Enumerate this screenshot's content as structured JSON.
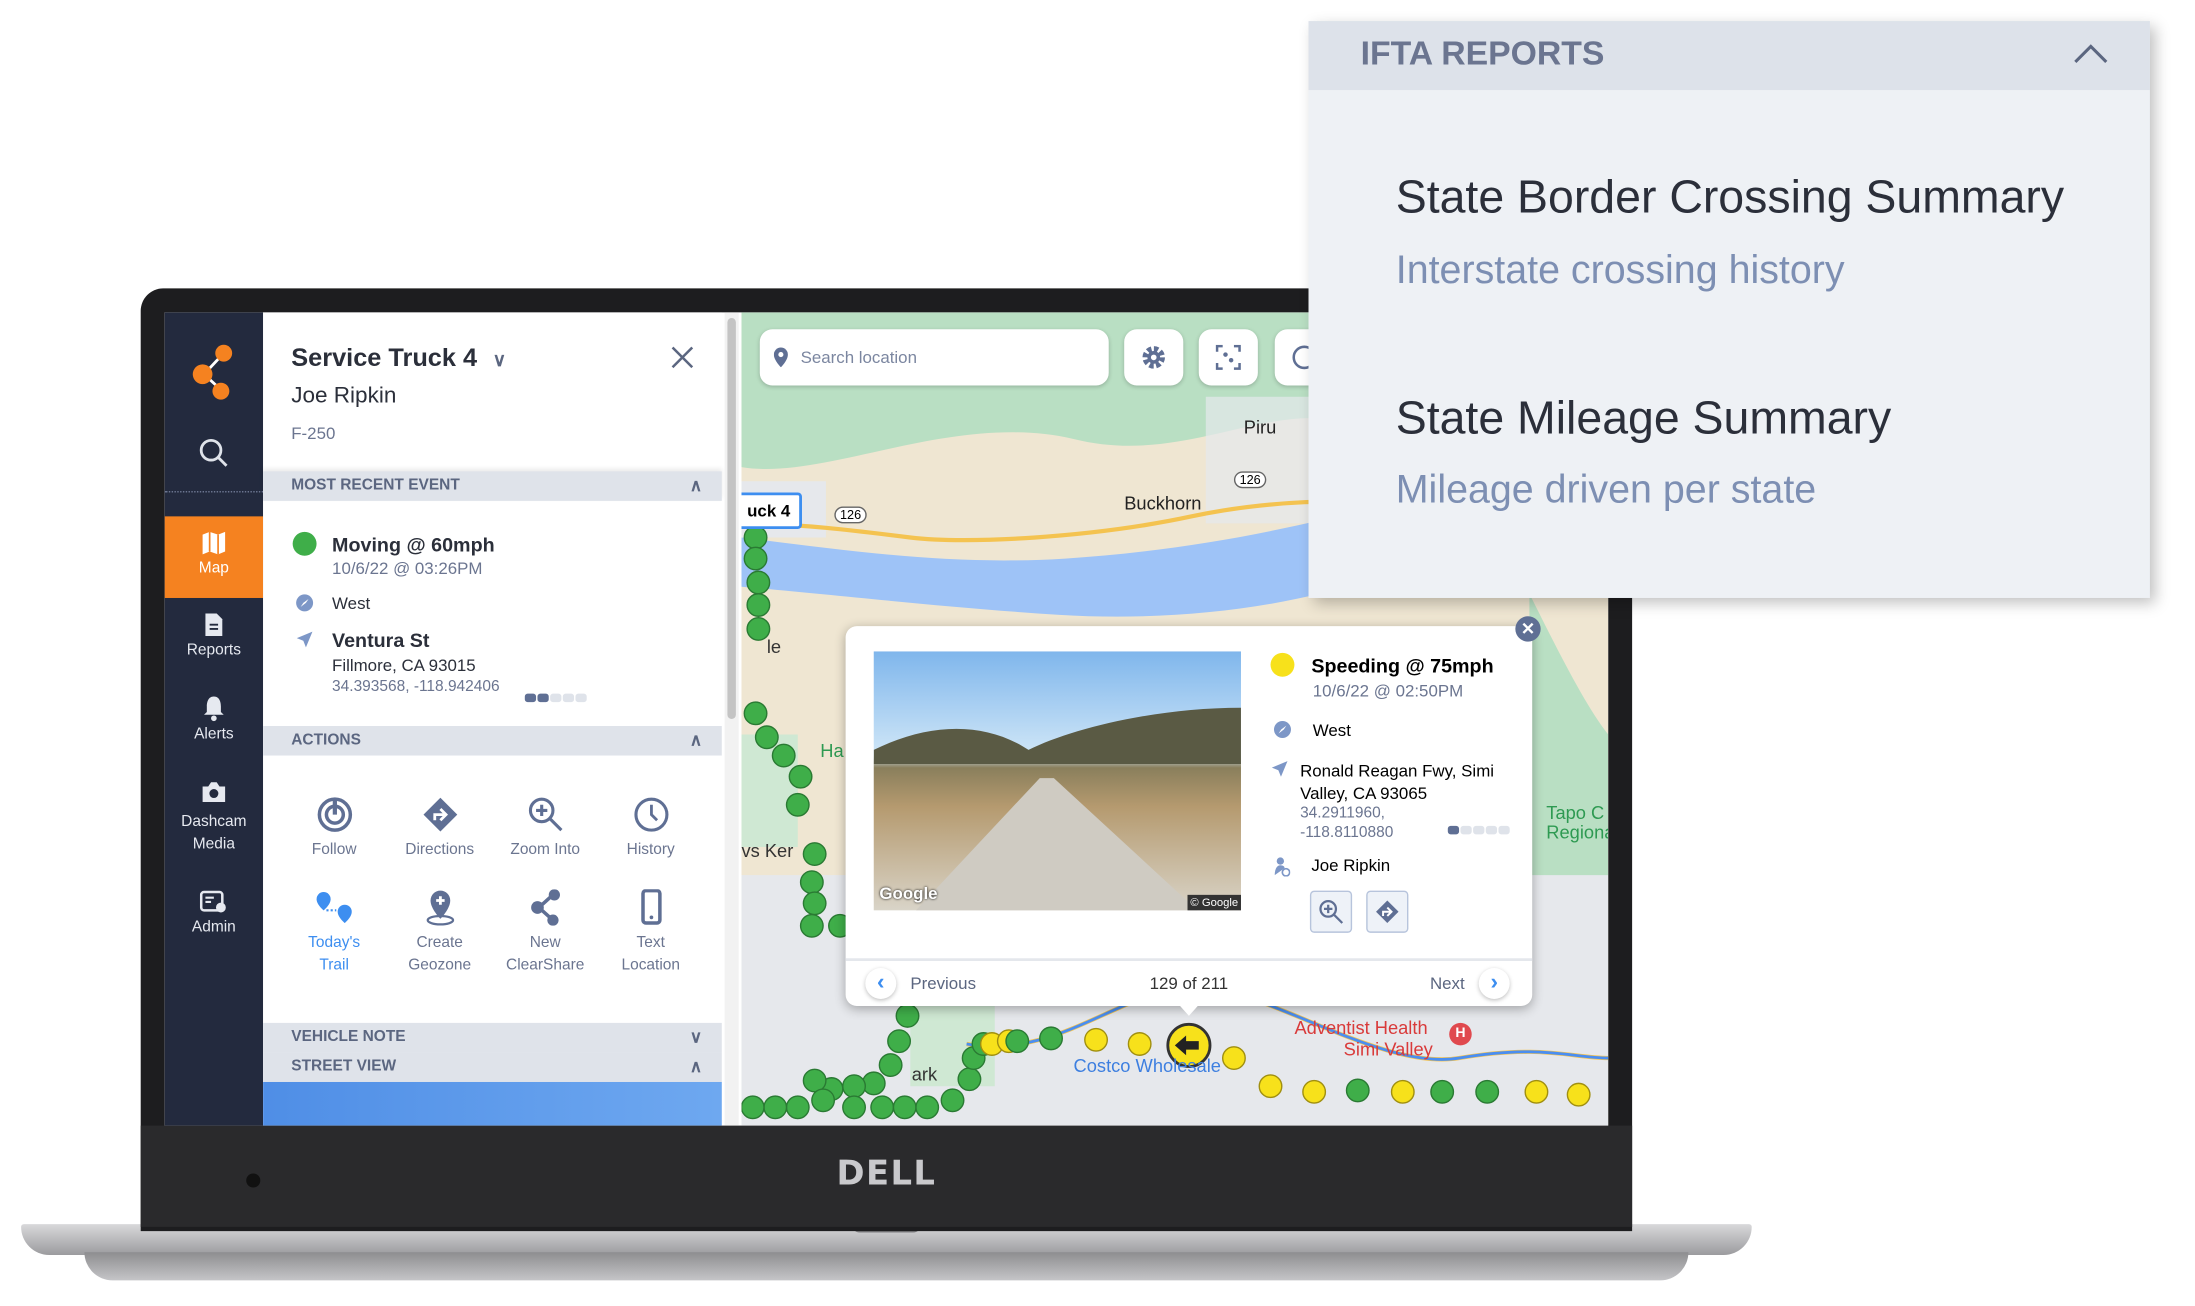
{
  "laptop": {
    "brand": "DELL"
  },
  "sidebar": {
    "logo": "clearpathgps-share-logo",
    "items": [
      {
        "label": "Map",
        "icon": "map-icon",
        "active": true
      },
      {
        "label": "Reports",
        "icon": "document-icon"
      },
      {
        "label": "Alerts",
        "icon": "bell-icon"
      },
      {
        "label": "Dashcam Media",
        "label_line1": "Dashcam",
        "label_line2": "Media",
        "icon": "camera-icon"
      },
      {
        "label": "Admin",
        "icon": "admin-icon"
      }
    ]
  },
  "vehicle": {
    "name": "Service Truck 4",
    "driver": "Joe Ripkin",
    "model": "F-250"
  },
  "recent_event": {
    "header": "MOST RECENT EVENT",
    "status": "Moving @ 60mph",
    "status_color": "#3fae49",
    "timestamp": "10/6/22 @ 03:26PM",
    "heading": "West",
    "street": "Ventura St",
    "city": "Fillmore, CA 93015",
    "coords": "34.393568, -118.942406",
    "signal_level": 0.4
  },
  "actions": {
    "header": "ACTIONS",
    "items": [
      {
        "label": "Follow",
        "icon": "follow-icon"
      },
      {
        "label": "Directions",
        "icon": "directions-icon"
      },
      {
        "label": "Zoom Into",
        "icon": "zoom-in-icon"
      },
      {
        "label": "History",
        "icon": "clock-icon"
      },
      {
        "label_line1": "Today's",
        "label_line2": "Trail",
        "icon": "trail-icon",
        "active": true
      },
      {
        "label_line1": "Create",
        "label_line2": "Geozone",
        "icon": "geozone-icon"
      },
      {
        "label_line1": "New",
        "label_line2": "ClearShare",
        "icon": "share-icon"
      },
      {
        "label_line1": "Text",
        "label_line2": "Location",
        "icon": "phone-icon"
      }
    ]
  },
  "vehicle_note": {
    "header": "VEHICLE NOTE"
  },
  "street_view": {
    "header": "STREET VIEW"
  },
  "map": {
    "search_placeholder": "Search location",
    "vehicle_label": "uck 4",
    "places": [
      "Piru",
      "Buckhorn",
      "126",
      "126",
      "Costco Wholesale",
      "Adventist Health",
      "Simi Valley",
      "Tapo C",
      "Regiona",
      "Ha",
      "vs Ker",
      "ark",
      "le"
    ]
  },
  "popup": {
    "status": "Speeding @ 75mph",
    "status_color": "#f7e11b",
    "timestamp": "10/6/22 @ 02:50PM",
    "heading": "West",
    "address_line1": "Ronald Reagan Fwy, Simi",
    "address_line2": "Valley, CA 93065",
    "coords_line1": "34.2911960,",
    "coords_line2": "-118.8110880",
    "signal_level": 0.2,
    "driver": "Joe Ripkin",
    "image_watermark": "Google",
    "image_copyright": "© Google",
    "prev_label": "Previous",
    "next_label": "Next",
    "counter": "129 of 211"
  },
  "ifta": {
    "header": "IFTA REPORTS",
    "reports": [
      {
        "title": "State Border Crossing Summary",
        "subtitle": "Interstate crossing history"
      },
      {
        "title": "State Mileage Summary",
        "subtitle": "Mileage driven per state"
      }
    ]
  }
}
